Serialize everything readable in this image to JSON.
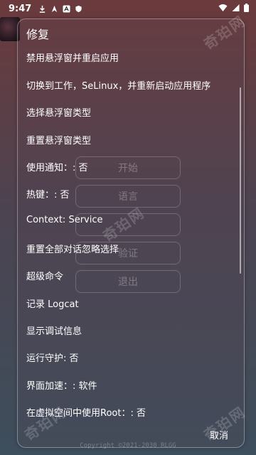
{
  "status_bar": {
    "time": "9:47",
    "left_icons": [
      "download-icon",
      "location-icon",
      "a-icon",
      "shield-icon"
    ],
    "right_icons": [
      "wifi-icon",
      "signal-icon",
      "battery-icon"
    ]
  },
  "background_app": {
    "buttons": [
      "开始",
      "语言",
      "",
      "验证",
      "退出"
    ],
    "copyright": "Copyright ©2021-2030 RLGG"
  },
  "dialog": {
    "title": "修复",
    "items": [
      "禁用悬浮窗并重启应用",
      "切换到工作，SeLinux，并重新启动应用程序",
      "选择悬浮窗类型",
      "重置悬浮窗类型",
      "使用通知：: 否",
      "热键：: 否",
      "Context: Service",
      "重置全部对话忽略选择",
      "超级命令",
      "记录 Logcat",
      "显示调试信息",
      "运行守护: 否",
      "界面加速：: 软件",
      "在虚拟空间中使用Root：: 否"
    ],
    "cancel_label": "取消"
  },
  "watermark_text": "奇珀网"
}
